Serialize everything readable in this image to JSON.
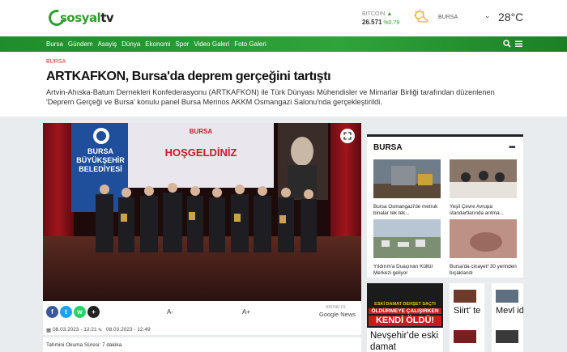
{
  "site": {
    "logo_prefix": "sosyal",
    "logo_suffix": "tv"
  },
  "ticker": {
    "label": "BITCOIN",
    "price": "26.571",
    "change": "%0.79"
  },
  "weather": {
    "city": "BURSA",
    "temp": "28°C"
  },
  "nav": {
    "items": [
      "Bursa",
      "Gündem",
      "Asayiş",
      "Dünya",
      "Ekonomi",
      "Spor",
      "Video Galeri",
      "Foto Galeri"
    ]
  },
  "article": {
    "category": "BURSA",
    "title": "ARTKAFKON, Bursa'da deprem gerçeğini tartıştı",
    "lead": "Artvin-Ahıska-Batum Dernekleri Konfederasyonu (ARTKAFKON) ile Türk Dünyası Mühendisler ve Mimarlar Birliği tarafından düzenlenen 'Deprem Gerçeği ve Bursa' konulu panel Bursa Merinos AKKM Osmangazi Salonu'nda gerçekleştirildi.",
    "photo_banner_1": "BURSA",
    "photo_banner_2": "BÜYÜKŞEHİR",
    "photo_banner_3": "BELEDİYESİ",
    "photo_screen_1": "BURSA",
    "photo_screen_2": "HOŞGELDİNİZ",
    "font_down": "A-",
    "font_up": "A+",
    "follow_label": "ABONE OL",
    "gnews_label": "Google News",
    "date_created": "08.03.2023 - 12:21",
    "date_updated": "08.03.2023 - 12:49",
    "read_time": "Tahmini Okuma Süresi: 7 dakika"
  },
  "share": {
    "facebook": "f",
    "twitter": "t",
    "whatsapp": "w",
    "more": "+"
  },
  "sidebar": {
    "title": "BURSA",
    "more": "•••",
    "cards": [
      {
        "caption": "Bursa Osmangazi'de metruk binalar tek tek..."
      },
      {
        "caption": "Yeşil Çevre Avrupa standartlarında arıtma..."
      },
      {
        "caption": "Yıldırım'a Duaçınarı Kültür Merkezi geliyor"
      },
      {
        "caption": "Bursa'da cinayet! 30 yerinden bıçaklandı"
      }
    ]
  },
  "promos": {
    "p1_line1": "ESKİ DAMAT DEHŞET SAÇTI",
    "p1_line2": "ÖLDÜRMEYE ÇALIŞIRKEN",
    "p1_line3": "KENDİ ÖLDÜ!",
    "p1_title": "Nevşehir'de eski damat",
    "p2_title": "Siirt' te",
    "p3_title": "Mevl id'i"
  },
  "colors": {
    "brand_green": "#2fa43a",
    "accent_red": "#d0342c"
  }
}
